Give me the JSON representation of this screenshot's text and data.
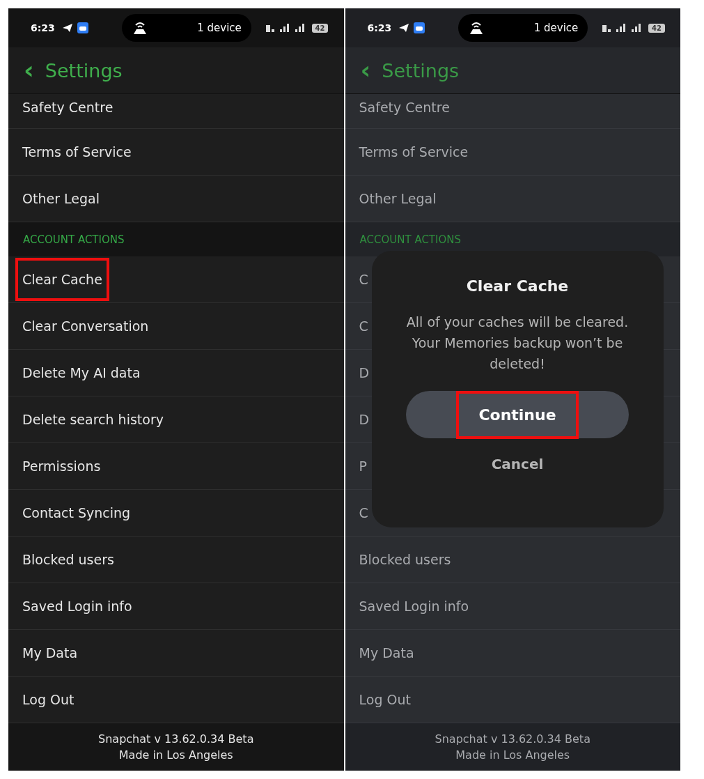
{
  "screens": [
    {
      "dimmed": false,
      "status_bar": {
        "time": "6:23",
        "pill_text": "1 device",
        "battery": "42"
      },
      "header": {
        "back": "‹",
        "title": "Settings"
      },
      "rows": [
        {
          "kind": "item",
          "label": "Safety Centre",
          "highlighted": false
        },
        {
          "kind": "item",
          "label": "Terms of Service",
          "highlighted": false
        },
        {
          "kind": "item",
          "label": "Other Legal",
          "highlighted": false
        },
        {
          "kind": "section",
          "label": "ACCOUNT ACTIONS"
        },
        {
          "kind": "item",
          "label": "Clear Cache",
          "highlighted": true
        },
        {
          "kind": "item",
          "label": "Clear Conversation",
          "highlighted": false
        },
        {
          "kind": "item",
          "label": "Delete My AI data",
          "highlighted": false
        },
        {
          "kind": "item",
          "label": "Delete search history",
          "highlighted": false
        },
        {
          "kind": "item",
          "label": "Permissions",
          "highlighted": false
        },
        {
          "kind": "item",
          "label": "Contact Syncing",
          "highlighted": false
        },
        {
          "kind": "item",
          "label": "Blocked users",
          "highlighted": false
        },
        {
          "kind": "item",
          "label": "Saved Login info",
          "highlighted": false
        },
        {
          "kind": "item",
          "label": "My Data",
          "highlighted": false
        },
        {
          "kind": "item",
          "label": "Log Out",
          "highlighted": false
        }
      ],
      "footer": [
        "Snapchat v 13.62.0.34 Beta",
        "Made in Los Angeles"
      ]
    },
    {
      "dimmed": true,
      "status_bar": {
        "time": "6:23",
        "pill_text": "1 device",
        "battery": "42"
      },
      "header": {
        "back": "‹",
        "title": "Settings"
      },
      "rows": [
        {
          "kind": "item",
          "label": "Safety Centre",
          "highlighted": false
        },
        {
          "kind": "item",
          "label": "Terms of Service",
          "highlighted": false
        },
        {
          "kind": "item",
          "label": "Other Legal",
          "highlighted": false
        },
        {
          "kind": "section",
          "label": "ACCOUNT ACTIONS"
        },
        {
          "kind": "item",
          "label": "C",
          "highlighted": false
        },
        {
          "kind": "item",
          "label": "C",
          "highlighted": false
        },
        {
          "kind": "item",
          "label": "D",
          "highlighted": false
        },
        {
          "kind": "item",
          "label": "D",
          "highlighted": false
        },
        {
          "kind": "item",
          "label": "P",
          "highlighted": false
        },
        {
          "kind": "item",
          "label": "C",
          "highlighted": false
        },
        {
          "kind": "item",
          "label": "Blocked users",
          "highlighted": false
        },
        {
          "kind": "item",
          "label": "Saved Login info",
          "highlighted": false
        },
        {
          "kind": "item",
          "label": "My Data",
          "highlighted": false
        },
        {
          "kind": "item",
          "label": "Log Out",
          "highlighted": false
        }
      ],
      "footer": [
        "Snapchat v 13.62.0.34 Beta",
        "Made in Los Angeles"
      ],
      "dialog": {
        "title": "Clear Cache",
        "message": "All of your caches will be cleared. Your Memories backup won’t be deleted!",
        "confirm": {
          "label": "Continue",
          "highlighted": true
        },
        "cancel": "Cancel"
      }
    }
  ]
}
